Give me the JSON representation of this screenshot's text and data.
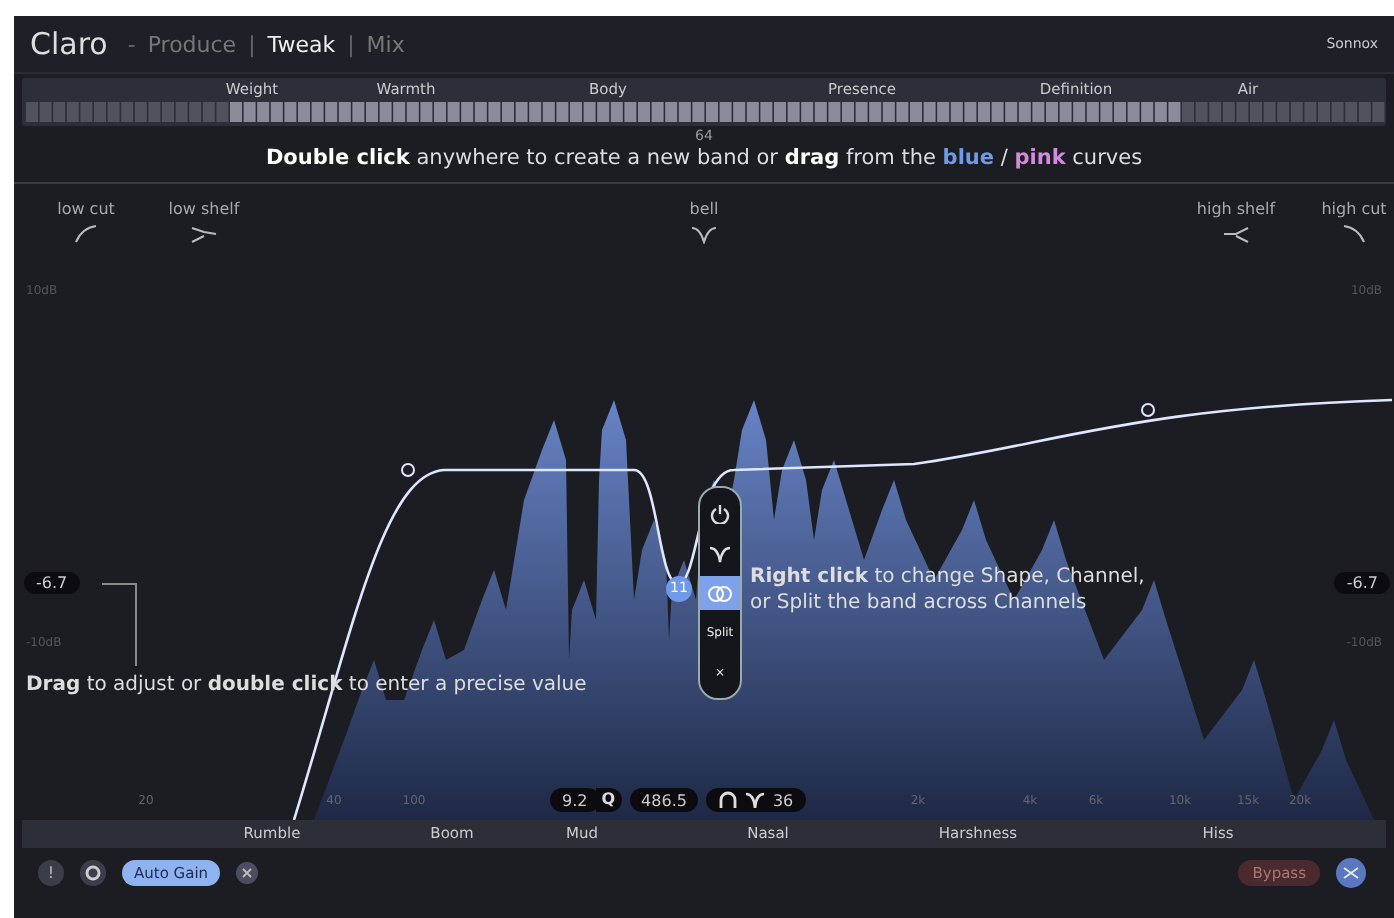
{
  "header": {
    "logo": "Claro",
    "separator": "-",
    "modes": [
      {
        "label": "Produce",
        "selected": false
      },
      {
        "label": "Tweak",
        "selected": true
      },
      {
        "label": "Mix",
        "selected": false
      }
    ],
    "mode_dividers": [
      "|",
      "|"
    ],
    "brand": "Sonnox"
  },
  "tone_regions": [
    "Weight",
    "Warmth",
    "Body",
    "Presence",
    "Definition",
    "Air"
  ],
  "keyboard": {
    "marker": "64"
  },
  "hint": "**Double click** anywhere to create a new band or **drag** from the **blue** / **pink** curves",
  "band_types": [
    {
      "label": "low cut",
      "kind": "lowcut"
    },
    {
      "label": "low shelf",
      "kind": "lowshelf"
    },
    {
      "label": "bell",
      "kind": "bell"
    },
    {
      "label": "high shelf",
      "kind": "highshelf"
    },
    {
      "label": "high cut",
      "kind": "highcut"
    }
  ],
  "gain_scale": {
    "top_left": "10dB",
    "top_right": "10dB",
    "mid_left": "-10dB",
    "mid_right": "-10dB"
  },
  "gain_readouts": [
    "-6.7",
    "-6.7"
  ],
  "band_menu": {
    "band_number": "11",
    "items": [
      {
        "kind": "power",
        "selected": false
      },
      {
        "kind": "shape",
        "selected": false
      },
      {
        "kind": "channel",
        "selected": true
      },
      {
        "kind": "split",
        "label": "Split",
        "selected": false
      },
      {
        "kind": "close",
        "label": "×",
        "selected": false
      }
    ]
  },
  "tips": [
    "**Right click** to change Shape, Channel,\nor Split the band across Channels",
    "**Drag** to adjust or **double click** to enter a precise value"
  ],
  "band_params": {
    "q": "9.2",
    "q_label": "Q",
    "frequency": "486.5",
    "slope": "36"
  },
  "freq_ticks": [
    "20",
    "40",
    "100",
    "2k",
    "4k",
    "6k",
    "10k",
    "15k",
    "20k"
  ],
  "problem_regions": [
    "Rumble",
    "Boom",
    "Mud",
    "Nasal",
    "Harshness",
    "Hiss"
  ],
  "footer": {
    "info": "!",
    "auto_gain": {
      "label": "Auto Gain",
      "on": true
    },
    "bypass": {
      "label": "Bypass",
      "on": false
    }
  }
}
